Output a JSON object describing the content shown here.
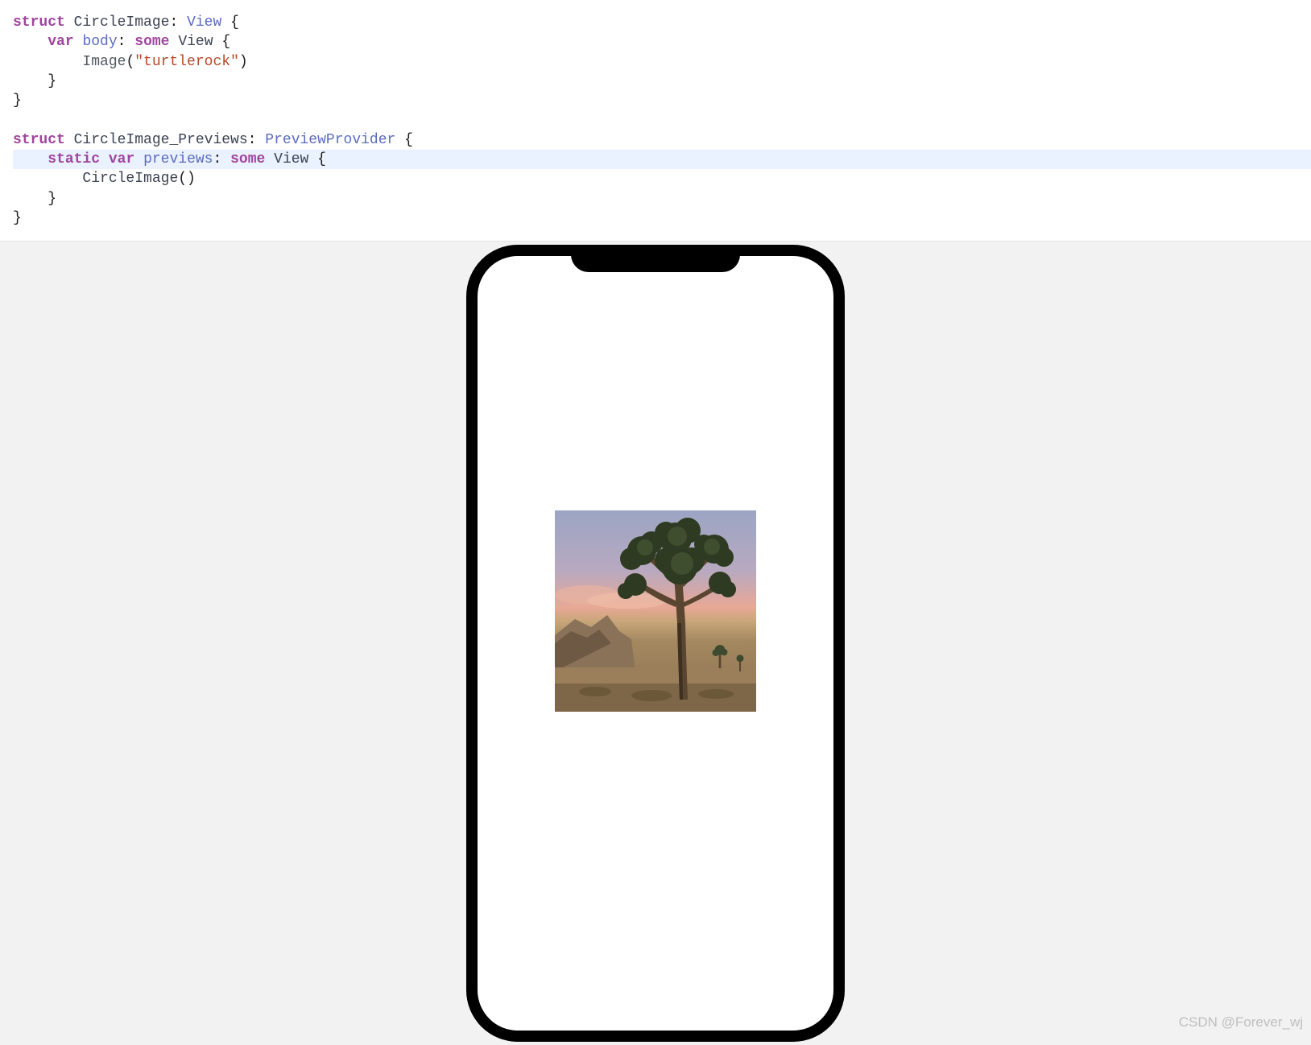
{
  "code": {
    "line1": {
      "struct": "struct",
      "name": "CircleImage",
      "colon": ":",
      "type": "View",
      "brace": " {"
    },
    "line2": {
      "indent": "    ",
      "var": "var",
      "body": "body",
      "colon": ":",
      "some": "some",
      "view": "View",
      "brace": " {"
    },
    "line3": {
      "indent": "        ",
      "image": "Image",
      "paren_open": "(",
      "string": "\"turtlerock\"",
      "paren_close": ")"
    },
    "line4": {
      "indent": "    ",
      "brace": "}"
    },
    "line5": {
      "brace": "}"
    },
    "line6": "",
    "line7": {
      "struct": "struct",
      "name": "CircleImage_Previews",
      "colon": ":",
      "type": "PreviewProvider",
      "brace": " {"
    },
    "line8": {
      "indent": "    ",
      "static": "static",
      "var": "var",
      "previews": "previews",
      "colon": ":",
      "some": "some",
      "view": "View",
      "brace": " {"
    },
    "line9": {
      "indent": "        ",
      "call": "CircleImage",
      "parens": "()"
    },
    "line10": {
      "indent": "    ",
      "brace": "}"
    },
    "line11": {
      "brace": "}"
    }
  },
  "preview": {
    "image_name": "turtlerock"
  },
  "watermark": "CSDN @Forever_wj"
}
